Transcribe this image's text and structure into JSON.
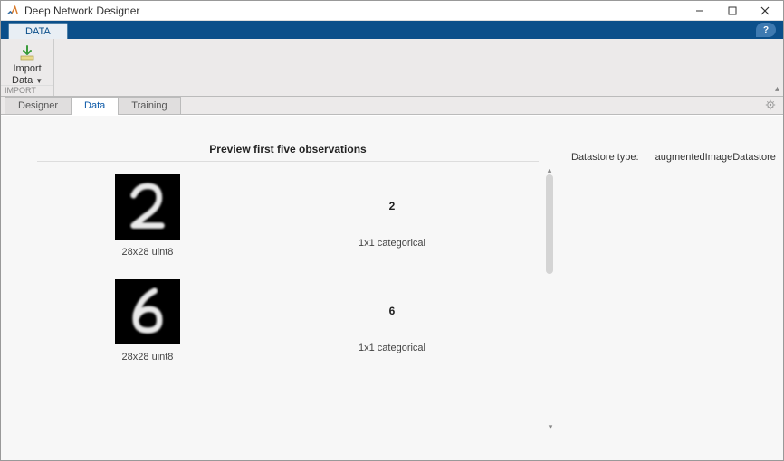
{
  "window": {
    "title": "Deep Network Designer"
  },
  "ribbon": {
    "active_tab": "DATA",
    "help_tooltip": "?"
  },
  "toolstrip": {
    "import": {
      "label_line1": "Import",
      "label_line2": "Data",
      "group_label": "IMPORT"
    }
  },
  "subtabs": {
    "designer": "Designer",
    "data": "Data",
    "training": "Training"
  },
  "preview": {
    "title": "Preview first five observations",
    "rows": [
      {
        "digit": "2",
        "img_caption": "28x28 uint8",
        "label": "2",
        "label_type": "1x1 categorical"
      },
      {
        "digit": "6",
        "img_caption": "28x28 uint8",
        "label": "6",
        "label_type": "1x1 categorical"
      }
    ]
  },
  "side": {
    "datastore_label": "Datastore type:",
    "datastore_value": "augmentedImageDatastore"
  }
}
